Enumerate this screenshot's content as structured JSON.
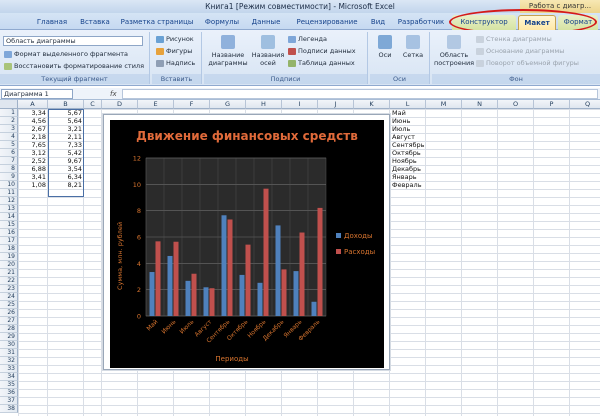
{
  "window": {
    "title": "Книга1 [Режим совместимости] - Microsoft Excel",
    "context_title": "Работа с диагр..."
  },
  "tabs": [
    {
      "label": "Главная"
    },
    {
      "label": "Вставка"
    },
    {
      "label": "Разметка страницы"
    },
    {
      "label": "Формулы"
    },
    {
      "label": "Данные"
    },
    {
      "label": "Рецензирование"
    },
    {
      "label": "Вид"
    },
    {
      "label": "Разработчик"
    },
    {
      "label": "Конструктор"
    },
    {
      "label": "Макет"
    },
    {
      "label": "Формат"
    }
  ],
  "ribbon": {
    "current_fragment": {
      "combo": "Область диаграммы",
      "format_selected": "Формат выделенного фрагмента",
      "reset_style": "Восстановить форматирование стиля",
      "label": "Текущий фрагмент"
    },
    "insert": {
      "picture": "Рисунок",
      "shapes": "Фигуры",
      "textbox": "Надпись",
      "label": "Вставить"
    },
    "labels_group": {
      "chart_title": "Название диаграммы",
      "axis_titles": "Названия осей",
      "legend": "Легенда",
      "data_labels": "Подписи данных",
      "data_table": "Таблица данных",
      "label": "Подписи"
    },
    "axes": {
      "axes": "Оси",
      "grid": "Сетка",
      "label": "Оси"
    },
    "background": {
      "plot_area": "Область построения",
      "chart_wall": "Стенка диаграммы",
      "chart_floor": "Основание диаграммы",
      "rotation": "Поворот объемной фигуры",
      "label": "Фон"
    }
  },
  "formula_bar": {
    "name_box": "Диаграмма 1",
    "fx": "fx",
    "value": ""
  },
  "columns": [
    "A",
    "B",
    "C",
    "D",
    "E",
    "F",
    "G",
    "H",
    "I",
    "J",
    "K",
    "L",
    "M",
    "N",
    "O",
    "P",
    "Q"
  ],
  "rows": [
    "1",
    "2",
    "3",
    "4",
    "5",
    "6",
    "7",
    "8",
    "9",
    "10",
    "11",
    "12",
    "13",
    "14",
    "15",
    "16",
    "17",
    "18",
    "19",
    "20",
    "21",
    "22",
    "23",
    "24",
    "25",
    "26",
    "27",
    "28",
    "29",
    "30",
    "31",
    "32",
    "33",
    "34",
    "35",
    "36",
    "37",
    "38"
  ],
  "cells": {
    "a": [
      "3,34",
      "4,56",
      "2,67",
      "2,18",
      "7,65",
      "3,12",
      "2,52",
      "6,88",
      "3,41",
      "1,08"
    ],
    "b": [
      "5,67",
      "5,64",
      "3,21",
      "2,11",
      "7,33",
      "5,42",
      "9,67",
      "3,54",
      "6,34",
      "8,21"
    ],
    "l": [
      "Май",
      "Июнь",
      "Июль",
      "Август",
      "Сентябрь",
      "Октябрь",
      "Ноябрь",
      "Декабрь",
      "Январь",
      "Февраль"
    ]
  },
  "chart_data": {
    "type": "bar",
    "title": "Движение финансовых средств",
    "xlabel": "Периоды",
    "ylabel": "Сумма, млн. рублей",
    "ylim": [
      0,
      12
    ],
    "yticks": [
      "0",
      "2",
      "4",
      "6",
      "8",
      "10",
      "12"
    ],
    "grid": true,
    "legend": "right",
    "categories": [
      "Май",
      "Июнь",
      "Июль",
      "Август",
      "Сентябрь",
      "Октябрь",
      "Ноябрь",
      "Декабрь",
      "Январь",
      "Февраль"
    ],
    "series": [
      {
        "name": "Доходы",
        "color": "#4f81bd",
        "values": [
          3.34,
          4.56,
          2.67,
          2.18,
          7.65,
          3.12,
          2.52,
          6.88,
          3.41,
          1.08
        ]
      },
      {
        "name": "Расходы",
        "color": "#c0504d",
        "values": [
          5.67,
          5.64,
          3.21,
          2.11,
          7.33,
          5.42,
          9.67,
          3.54,
          6.34,
          8.21
        ]
      }
    ]
  },
  "colors": {
    "chart_title": "#e06a3a",
    "axis_text": "#d9752f",
    "annotation": "#d41a1a"
  }
}
